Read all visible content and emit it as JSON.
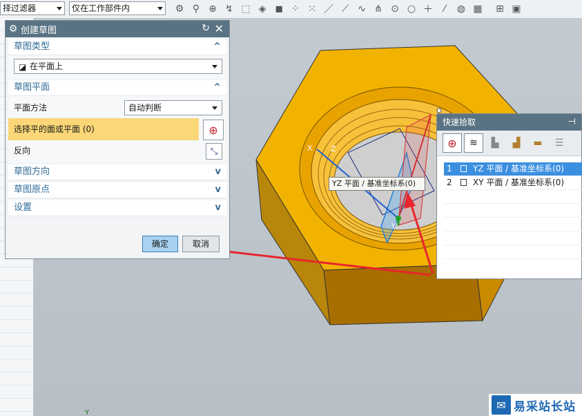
{
  "toolbar": {
    "filter_value": "择过滤器",
    "scope_value": "仅在工作部件内"
  },
  "dialog": {
    "title": "创建草图",
    "sections": {
      "sketch_type": {
        "title": "草图类型",
        "value": "在平面上"
      },
      "sketch_plane": {
        "title": "草图平面",
        "method_label": "平面方法",
        "method_value": "自动判断",
        "select_label": "选择平的面或平面 (0)",
        "reverse_label": "反向"
      },
      "sketch_direction": {
        "title": "草图方向"
      },
      "sketch_origin": {
        "title": "草图原点"
      },
      "settings": {
        "title": "设置"
      }
    },
    "ok_label": "确定",
    "cancel_label": "取消"
  },
  "quick_pick": {
    "title": "快速拾取",
    "items": [
      {
        "num": "1",
        "label": "YZ 平面 / 基准坐标系(0)"
      },
      {
        "num": "2",
        "label": "XY 平面 / 基准坐标系(0)"
      }
    ]
  },
  "tooltip": "YZ 平面 / 基准坐标系(0)",
  "axes": {
    "x": "X",
    "y": "Y",
    "z": "Z"
  },
  "watermark": "易采站长站",
  "colors": {
    "nut": "#f2b300",
    "titlebar": "#5a7384",
    "highlight": "#fbd777",
    "selection": "#3b8fe0",
    "arrow": "#e8262b"
  }
}
